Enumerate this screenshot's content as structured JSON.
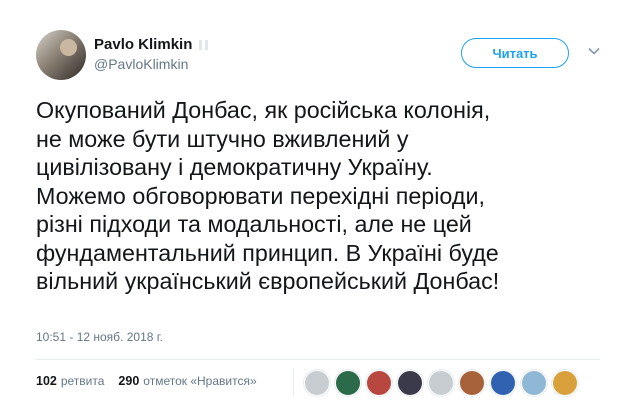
{
  "tweet": {
    "display_name": "Pavlo Klimkin",
    "handle": "@PavloKlimkin",
    "follow_label": "Читать",
    "text_lines": [
      "Окупований Донбас, як російська колонія,",
      "не може бути штучно вживлений у",
      "цивілізовану і демократичну Україну.",
      "Можемо обговорювати перехідні періоди,",
      "різні підходи та модальності, але не цей",
      "фундаментальний принцип. В Україні буде",
      "вільний український європейський Донбас!"
    ],
    "timestamp": "10:51 - 12 нояб. 2018 г."
  },
  "stats": {
    "retweet_count": "102",
    "retweet_label": "ретвита",
    "like_count": "290",
    "like_label": "отметок «Нравится»"
  },
  "likers": [
    {
      "name": "liker-avatar-1",
      "color": "#c7cdd1"
    },
    {
      "name": "liker-avatar-2",
      "color": "#2b6b4a"
    },
    {
      "name": "liker-avatar-3",
      "color": "#b8473f"
    },
    {
      "name": "liker-avatar-4",
      "color": "#3a3a4a"
    },
    {
      "name": "liker-avatar-5",
      "color": "#c7cdd1"
    },
    {
      "name": "liker-avatar-6",
      "color": "#a8623a"
    },
    {
      "name": "liker-avatar-7",
      "color": "#2f62b0"
    },
    {
      "name": "liker-avatar-8",
      "color": "#8fb7d6"
    },
    {
      "name": "liker-avatar-9",
      "color": "#d9a13b"
    }
  ],
  "colors": {
    "accent": "#1da1f2",
    "muted": "#657786",
    "divider": "#e6ecf0"
  }
}
